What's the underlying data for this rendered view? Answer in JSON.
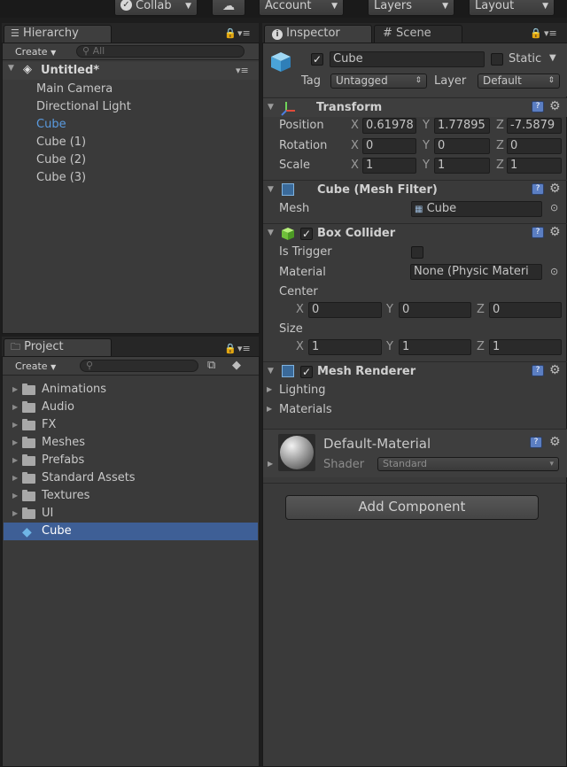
{
  "toolbar": {
    "collab": "Collab",
    "account": "Account",
    "layers": "Layers",
    "layout": "Layout"
  },
  "hierarchy": {
    "tab": "Hierarchy",
    "create": "Create",
    "search_placeholder": "All",
    "scene": "Untitled*",
    "items": [
      "Main Camera",
      "Directional Light",
      "Cube",
      "Cube (1)",
      "Cube (2)",
      "Cube (3)"
    ],
    "selected": "Cube"
  },
  "project": {
    "tab": "Project",
    "create": "Create",
    "folders": [
      "Animations",
      "Audio",
      "FX",
      "Meshes",
      "Prefabs",
      "Standard Assets",
      "Textures",
      "UI"
    ],
    "asset": "Cube"
  },
  "inspector": {
    "tab_inspector": "Inspector",
    "tab_scene": "Scene",
    "object_name": "Cube",
    "static_label": "Static",
    "tag_label": "Tag",
    "tag_value": "Untagged",
    "layer_label": "Layer",
    "layer_value": "Default",
    "transform": {
      "title": "Transform",
      "position_label": "Position",
      "rotation_label": "Rotation",
      "scale_label": "Scale",
      "position": {
        "x": "0.61978",
        "y": "1.77895",
        "z": "-7.5879"
      },
      "rotation": {
        "x": "0",
        "y": "0",
        "z": "0"
      },
      "scale": {
        "x": "1",
        "y": "1",
        "z": "1"
      }
    },
    "mesh_filter": {
      "title": "Cube (Mesh Filter)",
      "mesh_label": "Mesh",
      "mesh_value": "Cube"
    },
    "box_collider": {
      "title": "Box Collider",
      "is_trigger_label": "Is Trigger",
      "material_label": "Material",
      "material_value": "None (Physic Materi",
      "center_label": "Center",
      "center": {
        "x": "0",
        "y": "0",
        "z": "0"
      },
      "size_label": "Size",
      "size": {
        "x": "1",
        "y": "1",
        "z": "1"
      }
    },
    "mesh_renderer": {
      "title": "Mesh Renderer",
      "lighting": "Lighting",
      "materials": "Materials"
    },
    "material": {
      "name": "Default-Material",
      "shader_label": "Shader",
      "shader_value": "Standard"
    },
    "add_component": "Add Component",
    "axis_x": "X",
    "axis_y": "Y",
    "axis_z": "Z"
  },
  "colors": {
    "selection": "#3e5f96",
    "selected_text": "#5a9be0",
    "panel_bg": "#3a3a3a"
  }
}
